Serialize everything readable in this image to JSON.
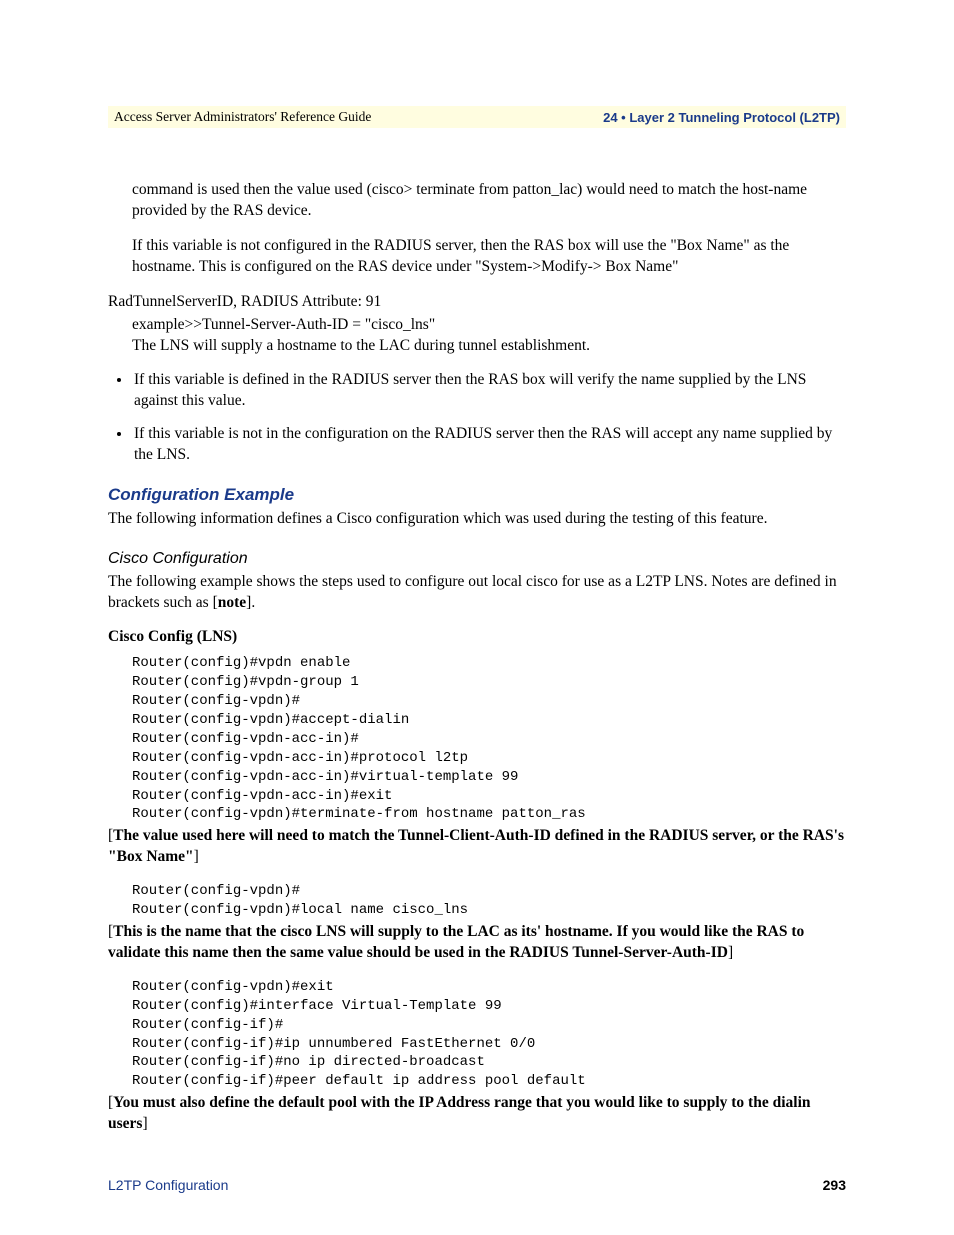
{
  "header": {
    "left": "Access Server Administrators' Reference Guide",
    "right": "24 • Layer 2 Tunneling Protocol (L2TP)"
  },
  "p1": "command is used then the value used (cisco> terminate from patton_lac) would need to match the host-name provided by the RAS device.",
  "p2": "If this variable is not configured in the RADIUS server, then the RAS box will use the \"Box Name\" as the hostname. This is configured on the RAS device under \"System->Modify-> Box Name\"",
  "p3": "RadTunnelServerID, RADIUS Attribute: 91",
  "p4a": "example>>Tunnel-Server-Auth-ID = \"cisco_lns\"",
  "p4b": "The LNS will supply a hostname to the LAC during tunnel establishment.",
  "b1": "If this variable is defined in the RADIUS server then the RAS box will verify the name supplied by the LNS against this value.",
  "b2": "If this variable is not in the configuration on the RADIUS server then the RAS will accept any name supplied by the LNS.",
  "h2": "Configuration Example",
  "p5": "The following information defines a Cisco configuration which was used during the testing of this feature.",
  "h3": "Cisco Configuration",
  "p6a": "The following example shows the steps used to configure out local cisco for use as a L2TP LNS. Notes are defined in brackets such as [",
  "p6b": "note",
  "p6c": "].",
  "p7": "Cisco Config (LNS)",
  "code1": "Router(config)#vpdn enable\nRouter(config)#vpdn-group 1\nRouter(config-vpdn)#\nRouter(config-vpdn)#accept-dialin\nRouter(config-vpdn-acc-in)#\nRouter(config-vpdn-acc-in)#protocol l2tp\nRouter(config-vpdn-acc-in)#virtual-template 99\nRouter(config-vpdn-acc-in)#exit\nRouter(config-vpdn)#terminate-from hostname patton_ras",
  "note1a": "[",
  "note1b": "The value used here will need to match the Tunnel-Client-Auth-ID defined in the RADIUS server, or the RAS's \"Box Name\"",
  "note1c": "]",
  "code2": "Router(config-vpdn)#\nRouter(config-vpdn)#local name cisco_lns",
  "note2a": "[",
  "note2b": "This is the name that the cisco LNS will supply to the LAC as its' hostname. If you would like the RAS to validate this name then the same value should be used in the RADIUS Tunnel-Server-Auth-ID",
  "note2c": "]",
  "code3": "Router(config-vpdn)#exit\nRouter(config)#interface Virtual-Template 99\nRouter(config-if)#\nRouter(config-if)#ip unnumbered FastEthernet 0/0\nRouter(config-if)#no ip directed-broadcast\nRouter(config-if)#peer default ip address pool default",
  "note3a": "[",
  "note3b": "You must also define the default pool with the IP Address range that you would like to supply to the dialin users",
  "note3c": "]",
  "footer": {
    "left": "L2TP Configuration",
    "right": "293"
  }
}
